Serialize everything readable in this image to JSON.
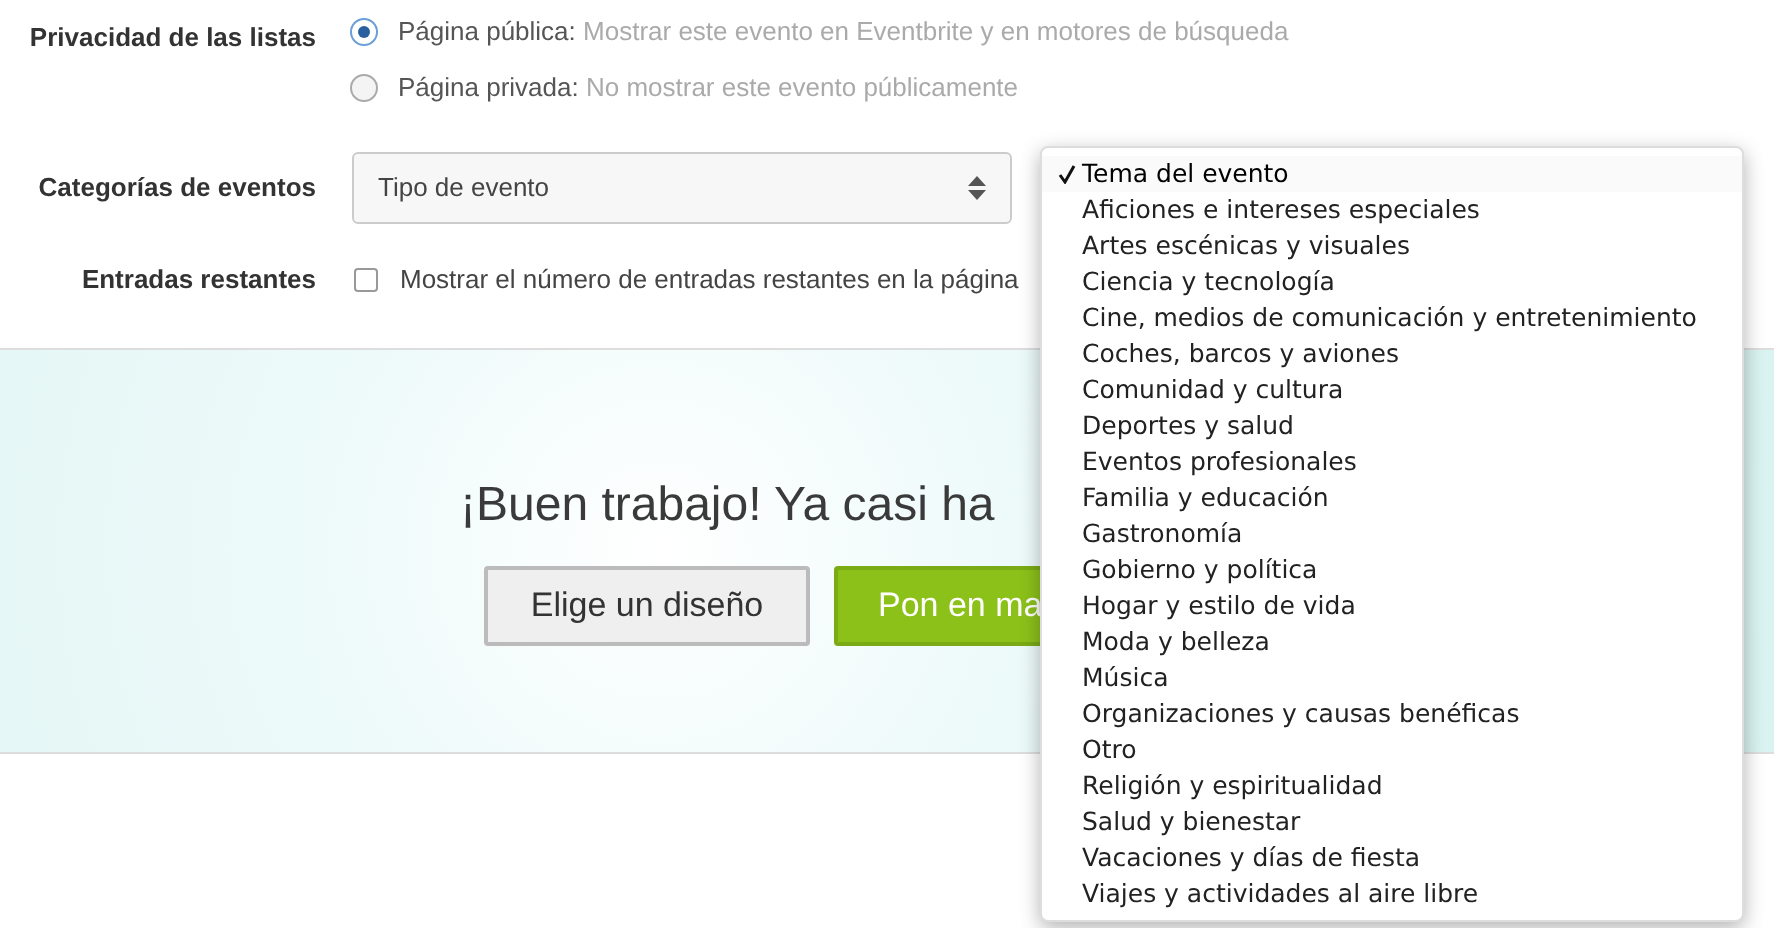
{
  "privacy": {
    "label": "Privacidad de las listas",
    "options": [
      {
        "title": "Página pública:",
        "description": "Mostrar este evento en Eventbrite y en motores de búsqueda",
        "selected": true
      },
      {
        "title": "Página privada:",
        "description": "No mostrar este evento públicamente",
        "selected": false
      }
    ]
  },
  "categories": {
    "label": "Categorías de eventos",
    "type_select": {
      "value": "Tipo de evento"
    },
    "topic_menu": {
      "items": [
        {
          "label": "Tema del evento",
          "selected": true
        },
        {
          "label": "Aficiones e intereses especiales",
          "selected": false
        },
        {
          "label": "Artes escénicas y visuales",
          "selected": false
        },
        {
          "label": "Ciencia y tecnología",
          "selected": false
        },
        {
          "label": "Cine, medios de comunicación y entretenimiento",
          "selected": false
        },
        {
          "label": "Coches, barcos y aviones",
          "selected": false
        },
        {
          "label": "Comunidad y cultura",
          "selected": false
        },
        {
          "label": "Deportes y salud",
          "selected": false
        },
        {
          "label": "Eventos profesionales",
          "selected": false
        },
        {
          "label": "Familia y educación",
          "selected": false
        },
        {
          "label": "Gastronomía",
          "selected": false
        },
        {
          "label": "Gobierno y política",
          "selected": false
        },
        {
          "label": "Hogar y estilo de vida",
          "selected": false
        },
        {
          "label": "Moda y belleza",
          "selected": false
        },
        {
          "label": "Música",
          "selected": false
        },
        {
          "label": "Organizaciones y causas benéficas",
          "selected": false
        },
        {
          "label": "Otro",
          "selected": false
        },
        {
          "label": "Religión y espiritualidad",
          "selected": false
        },
        {
          "label": "Salud y bienestar",
          "selected": false
        },
        {
          "label": "Vacaciones y días de fiesta",
          "selected": false
        },
        {
          "label": "Viajes y actividades al aire libre",
          "selected": false
        }
      ]
    }
  },
  "remaining": {
    "label": "Entradas restantes",
    "checkbox": {
      "label": "Mostrar el número de entradas restantes en la página",
      "checked": false
    }
  },
  "banner": {
    "headline": "¡Buen trabajo! Ya casi ha",
    "buttons": [
      {
        "label": "Elige un diseño",
        "kind": "secondary"
      },
      {
        "label": "Pon en ma",
        "kind": "primary"
      }
    ]
  }
}
